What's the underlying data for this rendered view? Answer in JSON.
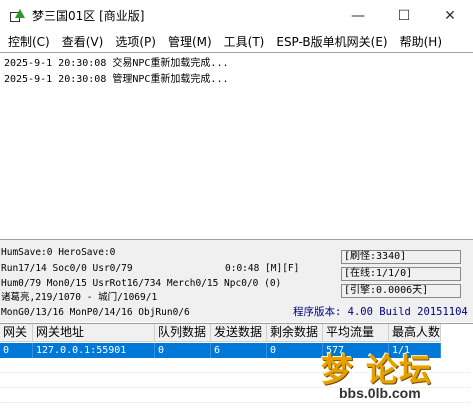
{
  "window": {
    "title": "梦三国01区 [商业版]"
  },
  "menu": [
    "控制(C)",
    "查看(V)",
    "选项(P)",
    "管理(M)",
    "工具(T)",
    "ESP-B版单机网关(E)",
    "帮助(H)"
  ],
  "log": [
    "2025-9-1 20:30:08 交易NPC重新加载完成...",
    "2025-9-1 20:30:08 管理NPC重新加载完成..."
  ],
  "status": {
    "line1": "HumSave:0 HeroSave:0",
    "line2": "Run17/14 Soc0/0 Usr0/79",
    "timer": "0:0:48 [M][F]",
    "line3": "Hum0/79 Mon0/15 UsrRot16/734 Merch0/15 Npc0/0 (0)",
    "line4": "诸葛亮,219/1070 - 城门/1069/1",
    "line5": "MonG0/13/16 MonP0/14/16 ObjRun0/6",
    "refresh": "[刷怪:3340]",
    "online": "[在线:1/1/0]",
    "engine": "[引擎:0.0006天]",
    "version": "程序版本: 4.00 Build 20151104"
  },
  "table": {
    "headers": [
      "网关",
      "网关地址",
      "队列数据",
      "发送数据",
      "剩余数据",
      "平均流量",
      "最高人数"
    ],
    "rows": [
      [
        "0",
        "127.0.0.1:55901",
        "0",
        "6",
        "0",
        "577",
        "1/1"
      ]
    ]
  },
  "watermark": {
    "main": "梦 论坛",
    "sub": "bbs.0lb.com"
  }
}
